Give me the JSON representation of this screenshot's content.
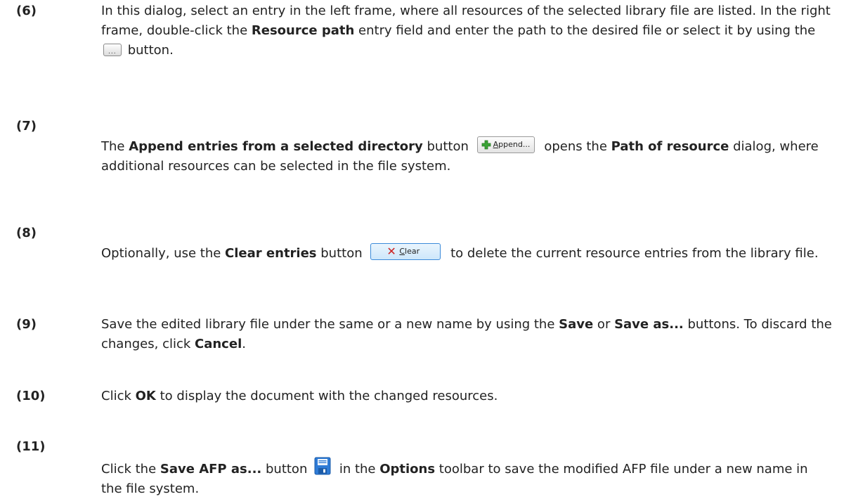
{
  "steps": [
    {
      "number": "(6)",
      "parts": {
        "p1": "In this dialog, select an entry in the left frame, where all resources of the selected library file are listed. In the right frame, double-click the ",
        "b1": "Resource path",
        "p2": " entry field and enter the path to the desired file or select it by using the ",
        "p3": " button."
      },
      "button": {
        "label": "...",
        "icon": "ellipsis-icon"
      }
    },
    {
      "number": "(7)",
      "parts": {
        "p1": "The ",
        "b1": "Append entries from a selected directory",
        "p2": " button ",
        "p3": " opens the ",
        "b2": "Path of resource",
        "p4": " dialog, where additional resources can be selected in the file system."
      },
      "button": {
        "label": "Append...",
        "icon": "green-plus-icon"
      }
    },
    {
      "number": "(8)",
      "parts": {
        "p1": "Optionally, use the ",
        "b1": "Clear entries",
        "p2": " button ",
        "p3": " to delete the current resource entries from the library file."
      },
      "button": {
        "label": "Clear",
        "icon": "red-x-icon"
      }
    },
    {
      "number": "(9)",
      "parts": {
        "p1": "Save the edited library file under the same or a new name by using the ",
        "b1": "Save",
        "p2": " or ",
        "b2": "Save as...",
        "p3": " buttons. To discard the changes, click ",
        "b3": "Cancel",
        "p4": "."
      }
    },
    {
      "number": "(10)",
      "parts": {
        "p1": "Click ",
        "b1": "OK",
        "p2": " to display the document with the changed resources."
      }
    },
    {
      "number": "(11)",
      "parts": {
        "p1": "Click the ",
        "b1": "Save AFP as...",
        "p2": " button ",
        "p3": " in the ",
        "b2": "Options",
        "p4": " toolbar to save the modified AFP file under a new name in the file system."
      },
      "button": {
        "icon": "save-floppy-icon"
      }
    }
  ],
  "colors": {
    "text": "#222222",
    "save_icon_blue": "#2e7bd6",
    "clear_x_red": "#cc2222",
    "plus_green": "#3aa335"
  }
}
